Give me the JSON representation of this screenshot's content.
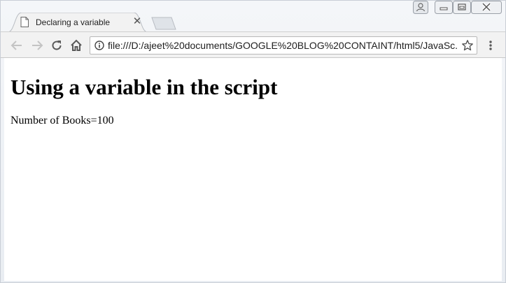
{
  "browser": {
    "tab": {
      "title": "Declaring a variable"
    },
    "address_bar": {
      "url": "file:///D:/ajeet%20documents/GOOGLE%20BLOG%20CONTAINT/html5/JavaSc..."
    },
    "icons": {
      "back": "back-arrow-icon",
      "forward": "forward-arrow-icon",
      "reload": "reload-icon",
      "home": "home-icon",
      "info": "info-icon",
      "bookmark": "star-icon",
      "menu": "kebab-menu-icon",
      "profile": "user-icon",
      "minimize": "minimize-icon",
      "restore": "restore-icon",
      "close": "close-icon"
    }
  },
  "page": {
    "heading": "Using a variable in the script",
    "paragraph": "Number of Books=100"
  }
}
